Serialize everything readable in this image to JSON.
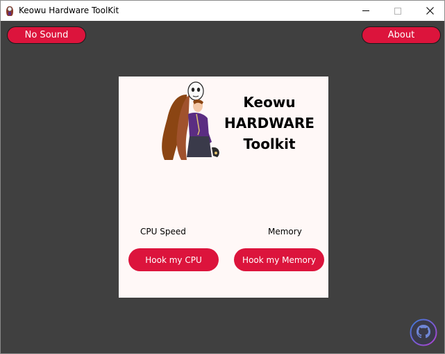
{
  "window": {
    "title": "Keowu Hardware ToolKit",
    "controls": {
      "minimize": "minimize-icon",
      "maximize": "maximize-icon",
      "close": "close-icon"
    }
  },
  "header": {
    "sound_button": "No Sound",
    "about_button": "About"
  },
  "card": {
    "title_line1": "Keowu",
    "title_line2": "HARDWARE",
    "title_line3": "Toolkit",
    "mascot": "anime-girl-mascot",
    "cpu_label": "CPU Speed",
    "memory_label": "Memory",
    "hook_cpu_button": "Hook my CPU",
    "hook_memory_button": "Hook my Memory"
  },
  "footer": {
    "link_icon": "github-icon"
  },
  "colors": {
    "client_background": "#404040",
    "accent": "#dc143c",
    "card_background": "#fff8f7",
    "title_bar": "#ffffff"
  }
}
